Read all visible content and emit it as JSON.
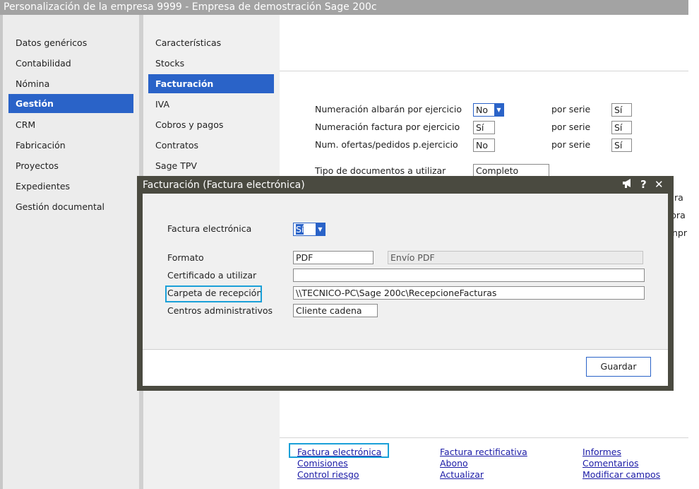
{
  "window": {
    "title": "Personalización de la empresa  9999 - Empresa de demostración Sage 200c"
  },
  "nav_primary": {
    "items": [
      {
        "label": "Datos genéricos",
        "active": false
      },
      {
        "label": "Contabilidad",
        "active": false
      },
      {
        "label": "Nómina",
        "active": false
      },
      {
        "label": "Gestión",
        "active": true
      },
      {
        "label": "CRM",
        "active": false
      },
      {
        "label": "Fabricación",
        "active": false
      },
      {
        "label": "Proyectos",
        "active": false
      },
      {
        "label": "Expedientes",
        "active": false
      },
      {
        "label": "Gestión documental",
        "active": false
      }
    ]
  },
  "nav_secondary": {
    "items": [
      {
        "label": "Características",
        "active": false
      },
      {
        "label": "Stocks",
        "active": false
      },
      {
        "label": "Facturación",
        "active": true
      },
      {
        "label": "IVA",
        "active": false
      },
      {
        "label": "Cobros y pagos",
        "active": false
      },
      {
        "label": "Contratos",
        "active": false
      },
      {
        "label": "Sage TPV",
        "active": false
      }
    ]
  },
  "main": {
    "rows": [
      {
        "label": "Numeración albarán por ejercicio",
        "value": "No",
        "por_serie_label": "por serie",
        "por_serie_value": "Sí"
      },
      {
        "label": "Numeración factura por ejercicio",
        "value": "Sí",
        "por_serie_label": "por serie",
        "por_serie_value": "Sí"
      },
      {
        "label": "Num. ofertas/pedidos p.ejercicio",
        "value": "No",
        "por_serie_label": "por serie",
        "por_serie_value": "Sí"
      }
    ],
    "tipo_documentos_label": "Tipo de documentos a utilizar",
    "tipo_documentos_value": "Completo",
    "clipped_right": [
      "ra",
      "bra",
      "npr"
    ]
  },
  "links": {
    "col1": [
      "Factura electrónica",
      "Comisiones",
      "Control riesgo"
    ],
    "col2": [
      "Factura rectificativa",
      "Abono",
      "Actualizar"
    ],
    "col3": [
      "Informes",
      "Comentarios",
      "Modificar campos"
    ]
  },
  "dialog": {
    "title": "Facturación (Factura electrónica)",
    "icons": [
      "megaphone-icon",
      "help-icon",
      "close-icon"
    ],
    "help_glyph": "?",
    "close_glyph": "✕",
    "factura_electronica_label": "Factura electrónica",
    "factura_electronica_value": "Sí",
    "formato_label": "Formato",
    "formato_value": "PDF",
    "envio_value": "Envío PDF",
    "certificado_label": "Certificado a utilizar",
    "certificado_value": "",
    "carpeta_label": "Carpeta de recepción",
    "carpeta_value": "\\\\TECNICO-PC\\Sage 200c\\RecepcioneFacturas",
    "centros_label": "Centros administrativos",
    "centros_value": "Cliente cadena",
    "save_label": "Guardar"
  },
  "colors": {
    "accent": "#2a63c8",
    "highlight": "#1aa0d8",
    "titlebar": "#a3a3a3",
    "dialog_frame": "#4a4a40",
    "link": "#1a1aa6"
  }
}
